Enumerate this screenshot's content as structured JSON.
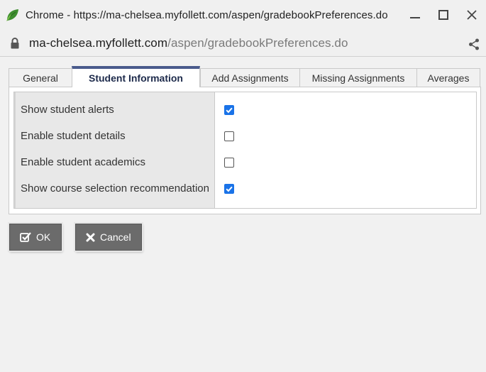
{
  "window": {
    "title": "Chrome - https://ma-chelsea.myfollett.com/aspen/gradebookPreferences.do"
  },
  "address_bar": {
    "host": "ma-chelsea.myfollett.com",
    "path": "/aspen/gradebookPreferences.do"
  },
  "tabs": [
    {
      "label": "General",
      "active": false
    },
    {
      "label": "Student Information",
      "active": true
    },
    {
      "label": "Add Assignments",
      "active": false
    },
    {
      "label": "Missing Assignments",
      "active": false
    },
    {
      "label": "Averages",
      "active": false
    }
  ],
  "settings": [
    {
      "label": "Show student alerts",
      "checked": true
    },
    {
      "label": "Enable student details",
      "checked": false
    },
    {
      "label": "Enable student academics",
      "checked": false
    },
    {
      "label": "Show course selection recommendation",
      "checked": true
    }
  ],
  "buttons": {
    "ok_label": "OK",
    "cancel_label": "Cancel"
  },
  "colors": {
    "active_tab_accent": "#4a5b8c",
    "checkbox_checked": "#1a73e8",
    "button_bg": "#6b6b6b"
  }
}
